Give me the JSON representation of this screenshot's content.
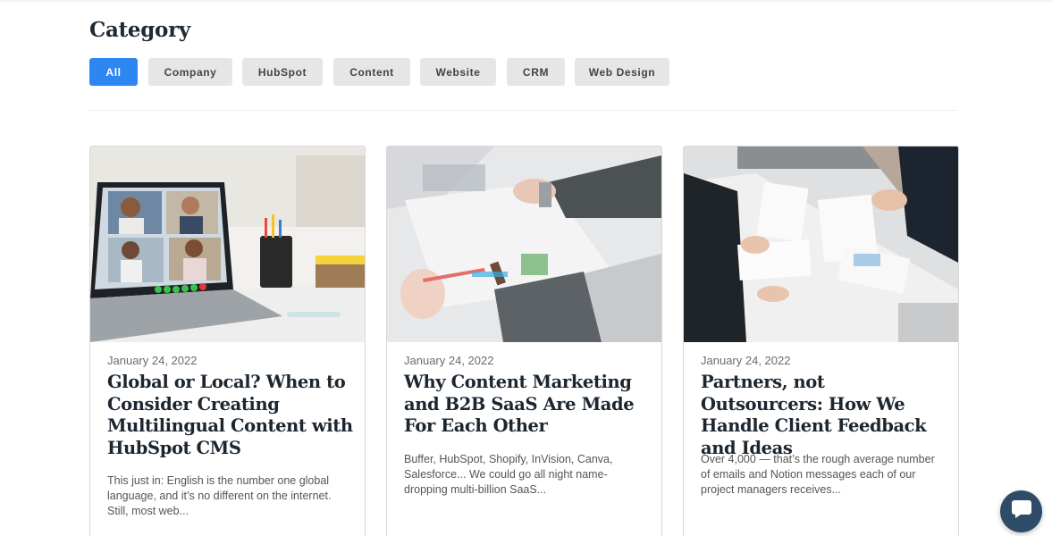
{
  "category": {
    "heading": "Category",
    "filters": [
      {
        "label": "All",
        "active": true
      },
      {
        "label": "Company",
        "active": false
      },
      {
        "label": "HubSpot",
        "active": false
      },
      {
        "label": "Content",
        "active": false
      },
      {
        "label": "Website",
        "active": false
      },
      {
        "label": "CRM",
        "active": false
      },
      {
        "label": "Web Design",
        "active": false
      }
    ]
  },
  "posts": [
    {
      "image": "video-call-laptop-image",
      "date": "January 24, 2022",
      "title": "Global or Local? When to Consider Creating Multilingual Content with HubSpot CMS",
      "excerpt": "This just in: English is the number one global language, and it’s no different on the internet. Still, most web..."
    },
    {
      "image": "marketing-desk-image",
      "date": "January 24, 2022",
      "title": "Why Content Marketing and B2B SaaS Are Made For Each Other",
      "excerpt": "Buffer, HubSpot, Shopify, InVision, Canva, Salesforce... We could go all night name-dropping multi-billion SaaS..."
    },
    {
      "image": "business-meeting-image",
      "date": "January 24, 2022",
      "title": "Partners, not Outsourcers: How We Handle Client Feedback and Ideas",
      "excerpt": "Over 4,000 — that’s the rough average number of emails and Notion messages each of our project managers receives..."
    }
  ],
  "chat": {
    "icon": "chat-bubble-icon"
  },
  "colors": {
    "accent": "#2e86f3",
    "chip": "#e6e6e6",
    "chat": "#2e4b67"
  }
}
